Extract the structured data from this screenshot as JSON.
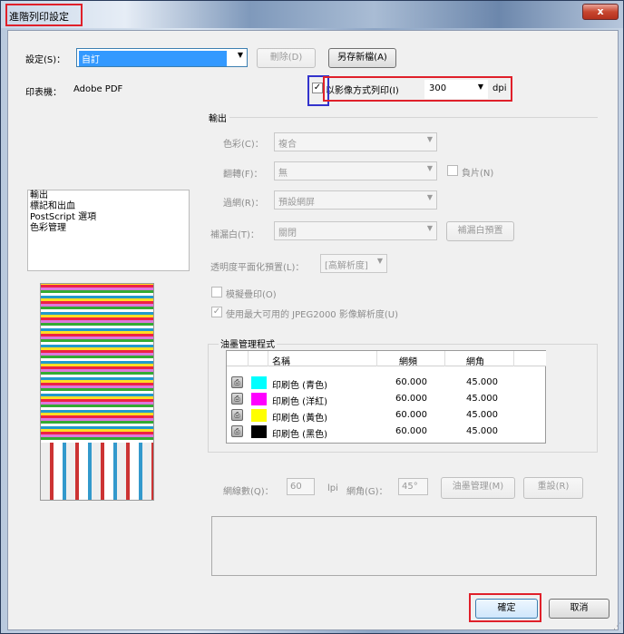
{
  "window": {
    "title": "進階列印設定",
    "close_label": "x"
  },
  "settings": {
    "label": "設定(S)：",
    "value": "自訂",
    "delete_button": "刪除(D)",
    "save_as_button": "另存新檔(A)"
  },
  "printer": {
    "label": "印表機：",
    "value": "Adobe PDF"
  },
  "print_as_image": {
    "label": "以影像方式列印(I)",
    "checked": true,
    "dpi_value": "300",
    "dpi_unit": "dpi"
  },
  "sections": {
    "items": [
      "輸出",
      "標記和出血",
      "PostScript 選項",
      "色彩管理"
    ],
    "selected": "輸出"
  },
  "output": {
    "group_title": "輸出",
    "color_label": "色彩(C)：",
    "color_value": "複合",
    "flip_label": "翻轉(F)：",
    "flip_value": "無",
    "negative_label": "負片(N)",
    "screening_label": "過網(R)：",
    "screening_value": "預設網屏",
    "trapping_label": "補漏白(T)：",
    "trapping_value": "關閉",
    "trap_presets_button": "補漏白預置",
    "transparency_label": "透明度平面化預置(L)：",
    "transparency_value": "[高解析度]",
    "simulate_overprint_label": "模擬疊印(O)",
    "jpeg2000_label": "使用最大可用的 JPEG2000 影像解析度(U)"
  },
  "ink_manager": {
    "group_title": "油墨管理程式",
    "columns": [
      "名稱",
      "網頻",
      "網角"
    ],
    "rows": [
      {
        "name": "印刷色 (青色)",
        "frequency": "60.000",
        "angle": "45.000",
        "color": "#00ffff"
      },
      {
        "name": "印刷色 (洋紅)",
        "frequency": "60.000",
        "angle": "45.000",
        "color": "#ff00ff"
      },
      {
        "name": "印刷色 (黃色)",
        "frequency": "60.000",
        "angle": "45.000",
        "color": "#ffff00"
      },
      {
        "name": "印刷色 (黑色)",
        "frequency": "60.000",
        "angle": "45.000",
        "color": "#000000"
      }
    ],
    "lines_label": "網線數(Q)：",
    "lines_value": "60",
    "lines_unit": "lpi",
    "angle_label": "網角(G)：",
    "angle_value": "45°",
    "ink_manager_button": "油墨管理(M)",
    "reset_button": "重設(R)"
  },
  "footer": {
    "ok_button": "確定",
    "cancel_button": "取消"
  },
  "colors": {
    "highlight_red": "#e0202a",
    "highlight_blue": "#3333cc",
    "selection": "#3399ff"
  }
}
